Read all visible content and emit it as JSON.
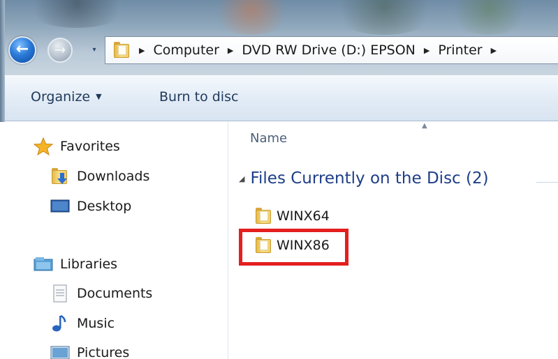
{
  "address_bar": {
    "path": [
      "Computer",
      "DVD RW Drive (D:) EPSON",
      "Printer"
    ]
  },
  "toolbar": {
    "organize_label": "Organize",
    "burn_label": "Burn to disc"
  },
  "nav": {
    "favorites_label": "Favorites",
    "downloads_label": "Downloads",
    "desktop_label": "Desktop",
    "libraries_label": "Libraries",
    "documents_label": "Documents",
    "music_label": "Music",
    "pictures_label": "Pictures"
  },
  "content": {
    "column_name": "Name",
    "group_title": "Files Currently on the Disc (2)",
    "files": [
      {
        "name": "WINX64"
      },
      {
        "name": "WINX86"
      }
    ]
  },
  "colors": {
    "highlight": "#e31f1f",
    "group_text": "#1e3e87"
  },
  "icons": {
    "back": "back-arrow-icon",
    "forward": "forward-arrow-icon",
    "folder": "folder-icon",
    "star": "star-icon",
    "music": "music-note-icon"
  }
}
